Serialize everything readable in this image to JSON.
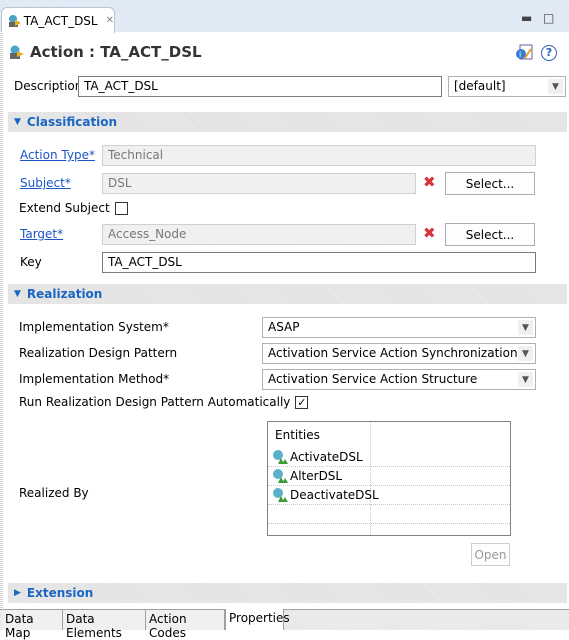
{
  "editor_tab": {
    "label": "TA_ACT_DSL",
    "close_icon": "close-icon"
  },
  "window_controls": {
    "minimize": "minimize-icon",
    "maximize": "maximize-icon"
  },
  "header": {
    "title": "Action : TA_ACT_DSL"
  },
  "description": {
    "label": "Description",
    "value": "TA_ACT_DSL",
    "locale": "[default]"
  },
  "classification": {
    "title": "Classification",
    "action_type": {
      "label": "Action Type*",
      "value": "Technical"
    },
    "subject": {
      "label": "Subject*",
      "value": "DSL",
      "select_label": "Select..."
    },
    "extend_subject": {
      "label": "Extend Subject",
      "checked": false
    },
    "target": {
      "label": "Target*",
      "value": "Access_Node",
      "select_label": "Select..."
    },
    "key": {
      "label": "Key",
      "value": "TA_ACT_DSL"
    }
  },
  "realization": {
    "title": "Realization",
    "implementation_system": {
      "label": "Implementation System*",
      "value": "ASAP"
    },
    "design_pattern": {
      "label": "Realization Design Pattern",
      "value": "Activation Service Action Synchronization"
    },
    "implementation_method": {
      "label": "Implementation Method*",
      "value": "Activation Service Action Structure"
    },
    "run_auto": {
      "label": "Run Realization Design Pattern Automatically",
      "checked": true
    },
    "realized_by": {
      "label": "Realized By",
      "column_header": "Entities",
      "rows": [
        {
          "name": "ActivateDSL"
        },
        {
          "name": "AlterDSL"
        },
        {
          "name": "DeactivateDSL"
        }
      ],
      "open_label": "Open"
    }
  },
  "extension": {
    "title": "Extension"
  },
  "bottom_tabs": [
    {
      "label": "Data Map",
      "active": false
    },
    {
      "label": "Data Elements",
      "active": false
    },
    {
      "label": "Action Codes",
      "active": false
    },
    {
      "label": "Properties",
      "active": true
    }
  ],
  "colors": {
    "section_title": "#1a66c4",
    "link": "#1a56c4",
    "remove": "#d9323a"
  }
}
